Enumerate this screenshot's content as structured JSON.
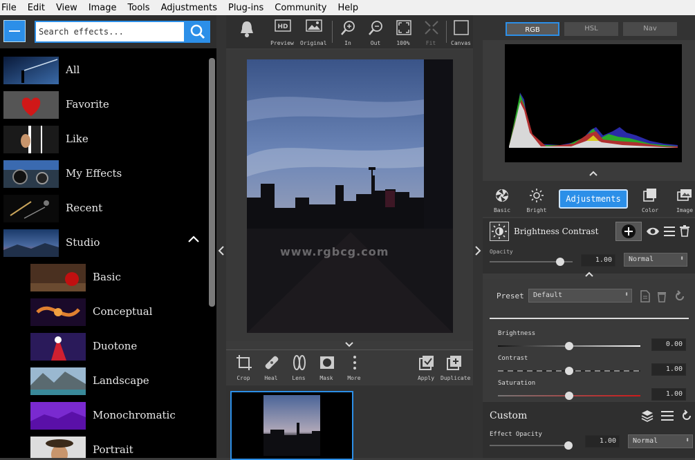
{
  "menu": [
    "File",
    "Edit",
    "View",
    "Image",
    "Tools",
    "Adjustments",
    "Plug-ins",
    "Community",
    "Help"
  ],
  "search": {
    "placeholder": "Search effects..."
  },
  "categories": [
    {
      "label": "All"
    },
    {
      "label": "Favorite"
    },
    {
      "label": "Like"
    },
    {
      "label": "My Effects"
    },
    {
      "label": "Recent"
    },
    {
      "label": "Studio"
    }
  ],
  "studio_items": [
    {
      "label": "Basic"
    },
    {
      "label": "Conceptual"
    },
    {
      "label": "Duotone"
    },
    {
      "label": "Landscape"
    },
    {
      "label": "Monochromatic"
    },
    {
      "label": "Portrait"
    }
  ],
  "toolbar": {
    "preview": "Preview",
    "original": "Original",
    "zoom_in": "In",
    "zoom_out": "Out",
    "zoom_100": "100%",
    "fit": "Fit",
    "canvas": "Canvas",
    "hd": "HD"
  },
  "watermark": "www.rgbcg.com",
  "edit_tools": {
    "crop": "Crop",
    "heal": "Heal",
    "lens": "Lens",
    "mask": "Mask",
    "more": "More",
    "apply": "Apply",
    "duplicate": "Duplicate"
  },
  "hist_tabs": {
    "rgb": "RGB",
    "hsl": "HSL",
    "nav": "Nav"
  },
  "adj_tabs": {
    "basic": "Basic",
    "bright": "Bright",
    "adjustments": "Adjustments",
    "color": "Color",
    "image": "Image"
  },
  "brightness_contrast": {
    "title": "Brightness Contrast",
    "opacity_label": "Opacity",
    "opacity_value": "1.00",
    "blend": "Normal",
    "opacity_level": 0.85
  },
  "preset": {
    "label": "Preset",
    "value": "Default"
  },
  "sliders": [
    {
      "label": "Brightness",
      "value": "0.00",
      "level": 0.5
    },
    {
      "label": "Contrast",
      "value": "1.00",
      "level": 0.5
    },
    {
      "label": "Saturation",
      "value": "1.00",
      "level": 0.5
    }
  ],
  "custom": {
    "title": "Custom",
    "effect_opacity_label": "Effect Opacity",
    "effect_opacity_value": "1.00",
    "blend": "Normal",
    "opacity_level": 0.98
  },
  "colors": {
    "accent": "#2c8fe8"
  }
}
